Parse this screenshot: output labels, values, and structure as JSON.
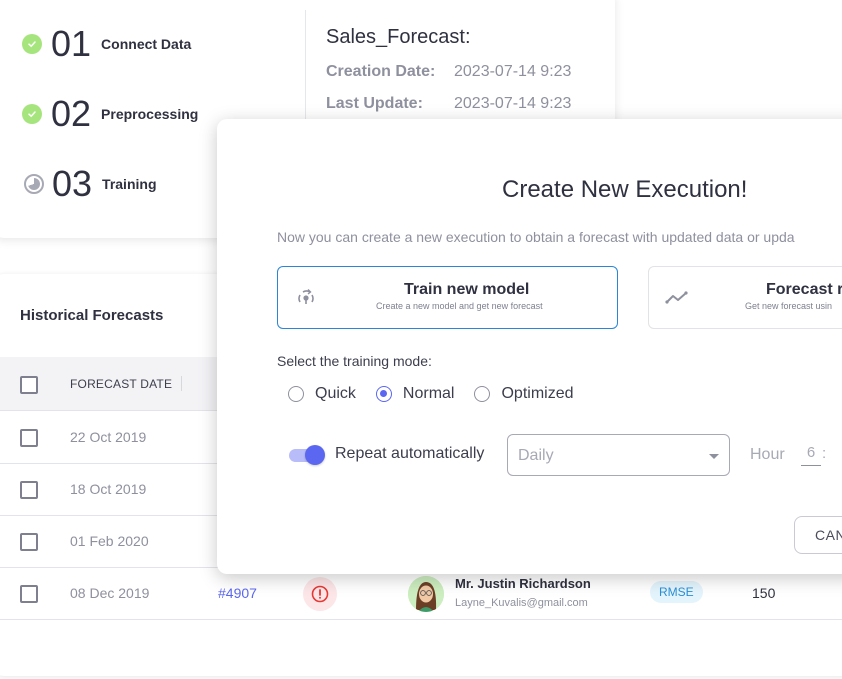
{
  "steps": [
    {
      "status": "done",
      "icon": "check-circle-icon",
      "number": "01",
      "label": "Connect Data"
    },
    {
      "status": "done",
      "icon": "check-circle-icon",
      "number": "02",
      "label": "Preprocessing"
    },
    {
      "status": "in-progress",
      "icon": "progress-circle-icon",
      "number": "03",
      "label": "Training"
    }
  ],
  "project": {
    "title": "Sales_Forecast:",
    "creation_label": "Creation Date:",
    "creation_value": "2023-07-14 9:23",
    "update_label": "Last Update:",
    "update_value": "2023-07-14 9:23"
  },
  "table": {
    "title": "Historical Forecasts",
    "columns": [
      "FORECAST DATE"
    ],
    "rows": [
      {
        "date": "22 Oct 2019"
      },
      {
        "date": "18 Oct 2019"
      },
      {
        "date": "01 Feb 2020"
      },
      {
        "date": "08 Dec 2019",
        "id": "#4907",
        "status_icon": "error-icon",
        "name": "Mr. Justin Richardson",
        "email": "Layne_Kuvalis@gmail.com",
        "metric": "RMSE",
        "value": "150"
      }
    ]
  },
  "modal": {
    "title": "Create New Execution!",
    "description": "Now you can create a new execution to obtain a forecast with updated data or upda",
    "options": [
      {
        "icon": "retrain-icon",
        "title": "Train new model",
        "subtitle": "Create a new model and get new forecast",
        "selected": true
      },
      {
        "icon": "trend-line-icon",
        "title": "Forecast r",
        "subtitle": "Get new forecast usin",
        "selected": false
      }
    ],
    "mode_label": "Select the training mode:",
    "modes": [
      {
        "label": "Quick",
        "checked": false
      },
      {
        "label": "Normal",
        "checked": true
      },
      {
        "label": "Optimized",
        "checked": false
      }
    ],
    "repeat_label": "Repeat automatically",
    "repeat_enabled": true,
    "frequency_value": "Daily",
    "hour_label": "Hour",
    "hour_value": "6",
    "hour_separator": ":",
    "cancel_label": "CAN"
  },
  "colors": {
    "accent": "#5b67f0",
    "selected_border": "#2c86d8",
    "success": "#a6e57d",
    "error_bg": "#fde6e7",
    "error": "#e53935",
    "badge_bg": "#e4f4fd",
    "badge_text": "#2a8fd6"
  }
}
